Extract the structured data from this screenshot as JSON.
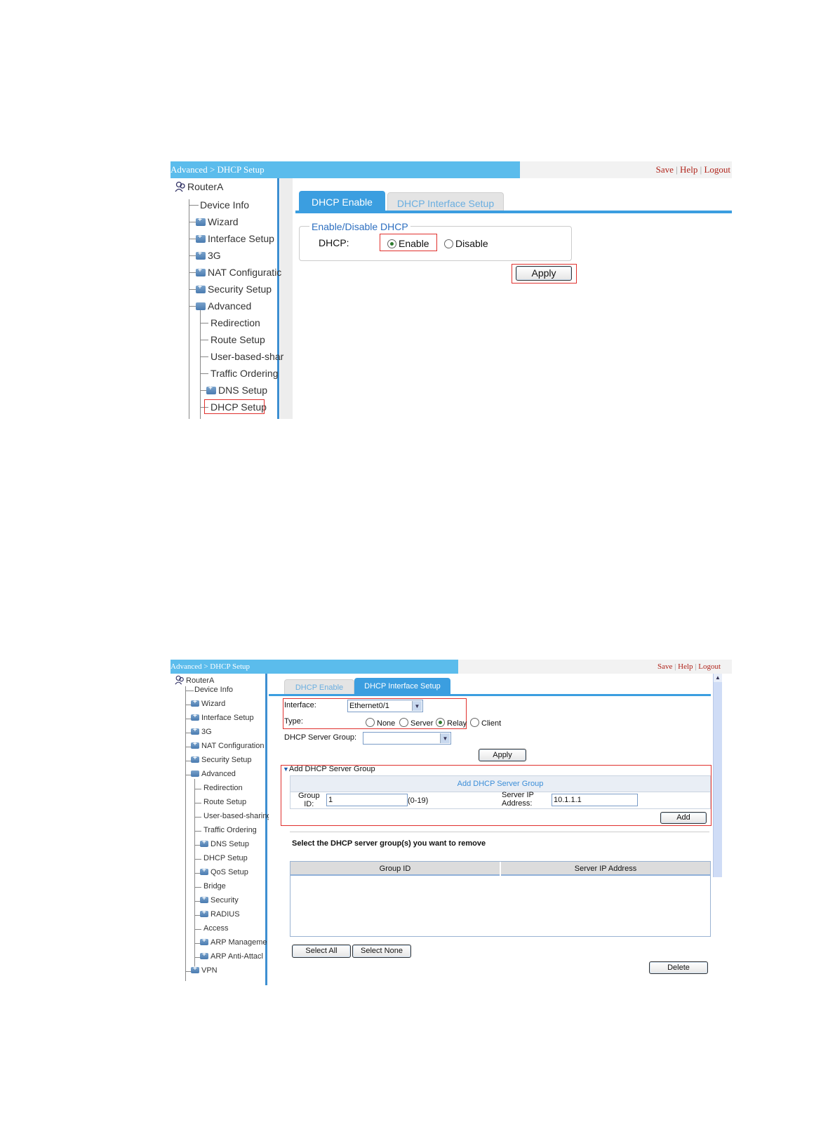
{
  "shot1": {
    "breadcrumb": "Advanced > DHCP Setup",
    "links": {
      "save": "Save",
      "help": "Help",
      "logout": "Logout",
      "sep": "|"
    },
    "sidebar": {
      "root": "RouterA",
      "items": [
        "Device Info",
        "Wizard",
        "Interface Setup",
        "3G",
        "NAT Configuratic",
        "Security Setup",
        "Advanced",
        "Redirection",
        "Route Setup",
        "User-based-shar",
        "Traffic Ordering",
        "DNS Setup",
        "DHCP Setup"
      ]
    },
    "tabs": [
      "DHCP Enable",
      "DHCP Interface Setup"
    ],
    "fieldset_legend": "Enable/Disable DHCP",
    "dhcp_label": "DHCP:",
    "enable_label": "Enable",
    "disable_label": "Disable",
    "apply_label": "Apply"
  },
  "shot2": {
    "breadcrumb": "Advanced > DHCP Setup",
    "links": {
      "save": "Save",
      "help": "Help",
      "logout": "Logout",
      "sep": "|"
    },
    "sidebar": {
      "root": "RouterA",
      "items": [
        "Device Info",
        "Wizard",
        "Interface Setup",
        "3G",
        "NAT Configuration",
        "Security Setup",
        "Advanced",
        "Redirection",
        "Route Setup",
        "User-based-sharing",
        "Traffic Ordering",
        "DNS Setup",
        "DHCP Setup",
        "QoS Setup",
        "Bridge",
        "Security",
        "RADIUS",
        "Access",
        "ARP Manageme",
        "ARP Anti-Attacl",
        "VPN"
      ]
    },
    "tabs": [
      "DHCP Enable",
      "DHCP Interface Setup"
    ],
    "interface_label": "Interface:",
    "interface_value": "Ethernet0/1",
    "type_label": "Type:",
    "type_options": [
      "None",
      "Server",
      "Relay",
      "Client"
    ],
    "server_group_label": "DHCP Server Group:",
    "apply_label": "Apply",
    "add_group_section": "Add DHCP Server Group",
    "add_group_header": "Add DHCP Server Group",
    "group_id_label_1": "Group",
    "group_id_label_2": "ID:",
    "group_id_value": "1",
    "group_id_range": "(0-19)",
    "server_ip_label_1": "Server IP",
    "server_ip_label_2": "Address:",
    "server_ip_value": "10.1.1.1",
    "add_label": "Add",
    "remove_prompt": "Select the DHCP server group(s) you want to remove",
    "table_headers": [
      "Group ID",
      "Server IP Address"
    ],
    "select_all_label": "Select All",
    "select_none_label": "Select None",
    "delete_label": "Delete"
  }
}
